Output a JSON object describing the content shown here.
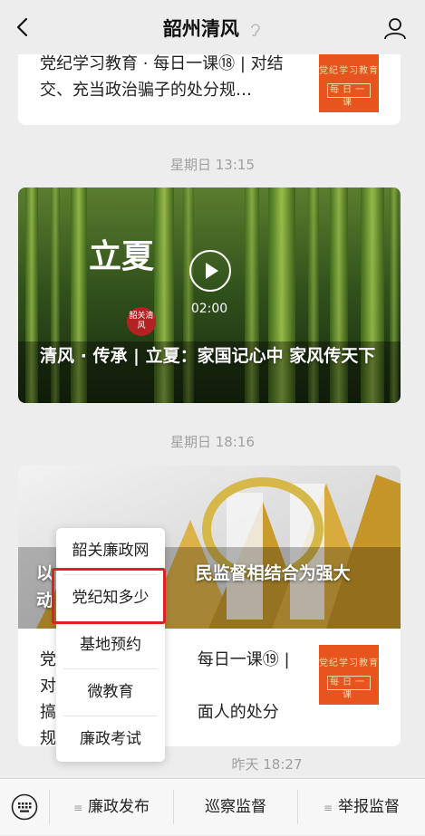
{
  "nav": {
    "title": "韶州清风",
    "back_icon": "chevron-left-icon",
    "profile_icon": "person-icon"
  },
  "messages": [
    {
      "type": "article",
      "title": "党纪学习教育 · 每日一课⑱ | 对结交、充当政治骗子的处分规…",
      "thumb_line1": "党纪学习教育",
      "thumb_line2": "每日一课"
    },
    {
      "timestamp": "星期日 13:15",
      "type": "video",
      "big_text": "立夏",
      "seal_text": "韶关清风",
      "duration": "02:00",
      "title": "清风 · 传承 | 立夏：家国记心中 家风传天下"
    },
    {
      "timestamp": "星期日 18:16",
      "type": "article_group",
      "hero_title": "以民监督相结合为强大动",
      "hero_title_visible_left": "以",
      "hero_title_visible_right": "民监督相结合为强大",
      "hero_line2": "动",
      "sub_title": "党纪学习教育 · 每日一课⑲ | 对搞团团伙伙等方面人的处分规…",
      "sub_visible_a": "党",
      "sub_visible_b": "每日一课⑲ | 对",
      "sub_visible_c": "搞",
      "sub_visible_d": "面人的处分规…",
      "thumb_line1": "党纪学习教育",
      "thumb_line2": "每日一课"
    },
    {
      "timestamp": "昨天 18:27"
    }
  ],
  "popup_menu": {
    "items": [
      "韶关廉政网",
      "党纪知多少",
      "基地预约",
      "微教育",
      "廉政考试"
    ],
    "highlighted_index": 1
  },
  "bottom_menu": {
    "keyboard_icon": "keyboard-icon",
    "tabs": [
      "廉政发布",
      "巡察监督",
      "举报监督"
    ]
  },
  "colors": {
    "background": "#ededed",
    "highlight": "#e02020",
    "thumb": "#e8541d"
  }
}
